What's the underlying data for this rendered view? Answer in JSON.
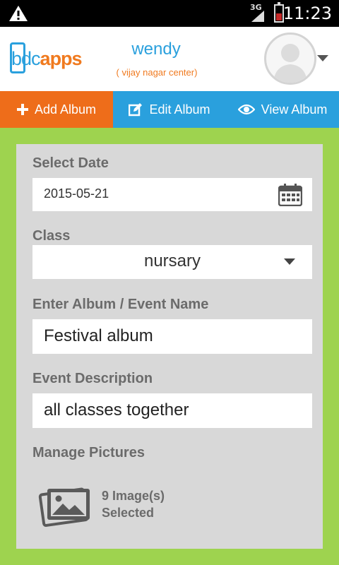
{
  "status_bar": {
    "network": "3G",
    "time": "11:23",
    "icons": [
      "warning-icon",
      "signal-icon",
      "battery-icon"
    ]
  },
  "header": {
    "logo": {
      "part1": "bdc",
      "part2": "apps"
    },
    "user_name": "wendy",
    "center": "( vijay nagar center)"
  },
  "tabs": [
    {
      "label": "Add Album",
      "icon": "plus-icon",
      "active": true
    },
    {
      "label": "Edit Album",
      "icon": "edit-icon",
      "active": false
    },
    {
      "label": "View Album",
      "icon": "eye-icon",
      "active": false
    }
  ],
  "form": {
    "date_label": "Select Date",
    "date_value": "2015-05-21",
    "class_label": "Class",
    "class_value": "nursary",
    "album_label": "Enter Album / Event Name",
    "album_value": "Festival album",
    "desc_label": "Event Description",
    "desc_value": "all classes together",
    "pictures_label": "Manage Pictures",
    "pictures_count": "9 Image(s)",
    "pictures_selected": "Selected"
  },
  "colors": {
    "accent_orange": "#ee6d1a",
    "accent_blue": "#2aa0dd",
    "background_green": "#9ed34f",
    "panel_gray": "#d8d8d8"
  }
}
